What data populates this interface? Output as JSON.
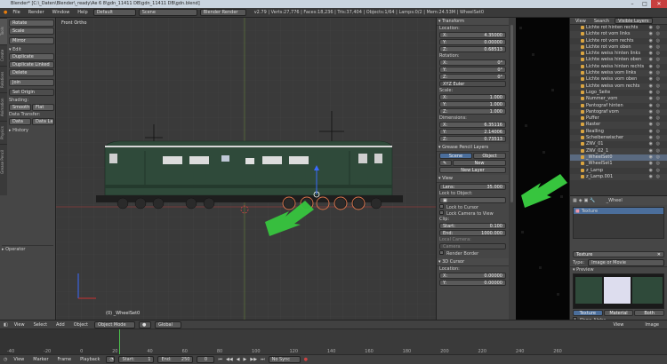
{
  "titlebar": {
    "title": "Blender* [C:\\_Daten\\Blender\\_ready\\Ae 6 8\\gdn_11411 DB\\gdn_11411 DB\\gdn.blend]",
    "win_min": "–",
    "win_max": "□",
    "win_close": "✕"
  },
  "menubar": {
    "items": [
      "File",
      "Render",
      "Window",
      "Help"
    ],
    "layout": "Default",
    "scene": "Scene",
    "engine": "Blender Render",
    "stats": "v2.79 | Verts:27,776 | Faces:18,236 | Tris:37,404 | Objects:1/64 | Lamps:0/2 | Mem:24.53M | WheelSet0"
  },
  "toolshelf": {
    "tabs": [
      "Tools",
      "Create",
      "Relations",
      "Animation",
      "Physics",
      "Grease Pencil"
    ],
    "transform_buttons": [
      "Rotate",
      "Scale",
      "Mirror"
    ],
    "edit_header": "Edit",
    "edit_buttons": [
      "Duplicate",
      "Duplicate Linked",
      "Delete",
      "Join"
    ],
    "set_origin": "Set Origin",
    "shading_label": "Shading:",
    "smooth": "Smooth",
    "flat": "Flat",
    "data_transfer_label": "Data Transfer:",
    "data": "Data",
    "data_layout": "Data La",
    "history": "History",
    "operator": "Operator"
  },
  "viewport": {
    "view_label": "Front Ortho",
    "object_label": "(0) _WheelSet0"
  },
  "properties": {
    "transform_header": "Transform",
    "location_label": "Location:",
    "location": [
      {
        "axis": "X:",
        "value": "4.35000"
      },
      {
        "axis": "Y:",
        "value": "0.00000"
      },
      {
        "axis": "Z:",
        "value": "0.68513"
      }
    ],
    "rotation_label": "Rotation:",
    "rotation": [
      {
        "axis": "X:",
        "value": "0°"
      },
      {
        "axis": "Y:",
        "value": "0°"
      },
      {
        "axis": "Z:",
        "value": "0°"
      }
    ],
    "rotation_mode": "XYZ Euler",
    "scale_label": "Scale:",
    "scale": [
      {
        "axis": "X:",
        "value": "1.000"
      },
      {
        "axis": "Y:",
        "value": "1.000"
      },
      {
        "axis": "Z:",
        "value": "1.000"
      }
    ],
    "dimensions_label": "Dimensions:",
    "dimensions": [
      {
        "axis": "X:",
        "value": "6.35116"
      },
      {
        "axis": "Y:",
        "value": "2.14006"
      },
      {
        "axis": "Z:",
        "value": "0.73513"
      }
    ],
    "grease_header": "Grease Pencil Layers",
    "scene_tab": "Scene",
    "object_tab": "Object",
    "new_btn": "New",
    "new_layer_btn": "New Layer",
    "view_header": "View",
    "lens_label": "Lens:",
    "lens_value": "35.000",
    "lock_object_label": "Lock to Object:",
    "lock_cursor": "Lock to Cursor",
    "lock_camera": "Lock Camera to View",
    "clip_label": "Clip:",
    "clip_start_label": "Start:",
    "clip_start": "0.100",
    "clip_end_label": "End:",
    "clip_end": "1000.000",
    "local_camera": "Local Camera:",
    "camera_value": "Camera",
    "render_border": "Render Border",
    "cursor_header": "3D Cursor",
    "cursor_location_label": "Location:",
    "cursor": [
      {
        "axis": "X:",
        "value": "0.00000"
      },
      {
        "axis": "Y:",
        "value": "0.00000"
      }
    ]
  },
  "outliner": {
    "view": "View",
    "search": "Search",
    "display": "Visible Layers",
    "items": [
      "Lichte rot hinten rechts",
      "Lichte rot vorn links",
      "Lichte rot vorn rechts",
      "Lichte rot vorn oben",
      "Lichte weiss hinten links",
      "Lichte weiss hinten oben",
      "Lichte weiss hinten rechts",
      "Lichte weiss vorn links",
      "Lichte weiss vorn oben",
      "Lichte weiss vorn rechts",
      "Logo_Seite",
      "Nummer_vorn",
      "Pantograf hinten",
      "Pantograf vorn",
      "Puffer",
      "Raster",
      "Realling",
      "Scheibenwischer",
      "ZNV_01",
      "ZNV_02_1",
      "_WheelSet0",
      "_WheelSet1",
      "z_Lamp",
      "z_Lamp.001"
    ]
  },
  "texture": {
    "object_name": "_Wheel",
    "tex_item": "Texture",
    "tex_name": "Texture",
    "type_label": "Type:",
    "type_value": "Image or Movie",
    "preview": "Preview",
    "tabs": [
      "Texture",
      "Material",
      "Both"
    ],
    "show_alpha": "Show Alpha"
  },
  "timeline": {
    "menus": [
      "View",
      "Select",
      "Add",
      "Object"
    ],
    "mode": "Object Mode",
    "orientation": "Global",
    "tl_menus": [
      "View",
      "Marker",
      "Frame",
      "Playback"
    ],
    "start_label": "Start:",
    "start": "1",
    "end_label": "End:",
    "end": "250",
    "current": "0",
    "sync": "No Sync",
    "ticks": [
      "-40",
      "-20",
      "0",
      "20",
      "40",
      "60",
      "80",
      "100",
      "120",
      "140",
      "160",
      "180",
      "200",
      "220",
      "240",
      "260"
    ],
    "outliner_view": "View",
    "outliner_image": "Image"
  },
  "colors": {
    "accent_green": "#3db83d",
    "selection_blue": "#4b6e9b",
    "locomotive": "#2f4a3a"
  }
}
